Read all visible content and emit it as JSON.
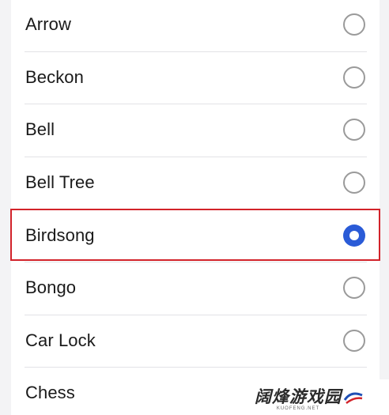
{
  "ringtones": [
    {
      "name": "Arrow",
      "selected": false
    },
    {
      "name": "Beckon",
      "selected": false
    },
    {
      "name": "Bell",
      "selected": false
    },
    {
      "name": "Bell Tree",
      "selected": false
    },
    {
      "name": "Birdsong",
      "selected": true
    },
    {
      "name": "Bongo",
      "selected": false
    },
    {
      "name": "Car Lock",
      "selected": false
    },
    {
      "name": "Chess",
      "selected": false
    }
  ],
  "watermark": {
    "main": "阔烽游戏园",
    "sub": "KUOFENG.NET"
  },
  "colors": {
    "accent": "#2a5bd7",
    "highlight": "#d2232a",
    "divider": "#e2e2e6"
  },
  "icons": {
    "unselected": "radio-unchecked-icon",
    "selected": "radio-checked-icon"
  }
}
